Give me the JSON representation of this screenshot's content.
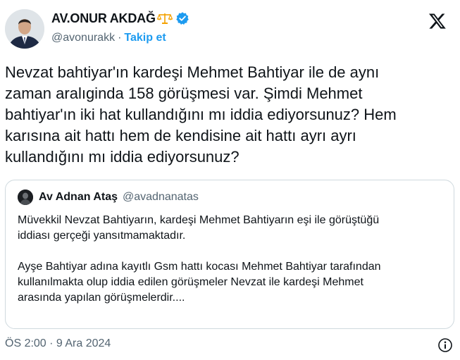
{
  "author": {
    "display_name": "AV.ONUR AKDAĞ",
    "handle": "@avonurakk",
    "separator": "·",
    "follow_label": "Takip et"
  },
  "tweet": {
    "text": "Nevzat bahtiyar'ın kardeşi Mehmet Bahtiyar ile de aynı\nzaman aralıginda 158 görüşmesi var. Şimdi Mehmet\nbahtiyar'ın iki hat kullandığını mı iddia ediyorsunuz? Hem\nkarısına ait hattı hem de kendisine ait hattı ayrı ayrı\nkullandığını mı iddia ediyorsunuz?"
  },
  "quote": {
    "display_name": "Av Adnan Ataş",
    "handle": "@avadnanatas",
    "text": "Müvekkil Nevzat Bahtiyarın, kardeşi Mehmet Bahtiyarın eşi ile görüştüğü\niddiası gerçeği yansıtmamaktadır.\n\nAyşe Bahtiyar adına kayıtlı Gsm hattı kocası Mehmet Bahtiyar tarafından\nkullanılmakta olup iddia edilen görüşmeler Nevzat ile kardeşi Mehmet\narasında yapılan görüşmelerdir...."
  },
  "timestamp": "ÖS 2:00 · 9 Ara 2024",
  "colors": {
    "accent": "#1d9bf0",
    "text": "#0f1419",
    "secondary": "#536471",
    "border": "#cfd9de",
    "scales": "#f4a100"
  },
  "icons": [
    "scales-icon",
    "verified-badge-icon",
    "x-logo-icon",
    "info-icon"
  ]
}
